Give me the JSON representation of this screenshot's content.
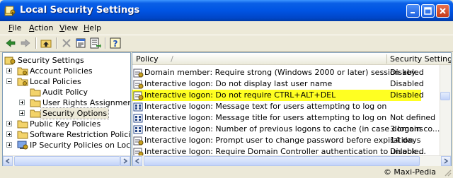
{
  "window": {
    "title": "Local Security Settings"
  },
  "menu": [
    {
      "label": "File",
      "key": "F",
      "rest": "ile"
    },
    {
      "label": "Action",
      "key": "A",
      "rest": "ction"
    },
    {
      "label": "View",
      "key": "V",
      "rest": "iew"
    },
    {
      "label": "Help",
      "key": "H",
      "rest": "elp"
    }
  ],
  "toolbar": [
    "back-icon",
    "forward-icon",
    "up-folder-icon",
    "delete-icon",
    "properties-icon",
    "export-list-icon",
    "help-icon"
  ],
  "tree": {
    "root": "Security Settings",
    "items": [
      {
        "label": "Account Policies"
      },
      {
        "label": "Local Policies"
      },
      {
        "label": "Audit Policy"
      },
      {
        "label": "User Rights Assignment"
      },
      {
        "label": "Security Options"
      },
      {
        "label": "Public Key Policies"
      },
      {
        "label": "Software Restriction Policies"
      },
      {
        "label": "IP Security Policies on Local Co"
      }
    ]
  },
  "list": {
    "columns": {
      "policy": "Policy",
      "setting": "Security Setting"
    },
    "sort_indicator": "/",
    "highlight_color": "#ffff22",
    "rows": [
      {
        "policy": "Domain member: Require strong (Windows 2000 or later) session key",
        "setting": "Disabled",
        "icon": "policy-toggle-icon"
      },
      {
        "policy": "Interactive logon: Do not display last user name",
        "setting": "Disabled",
        "icon": "policy-toggle-icon"
      },
      {
        "policy": "Interactive logon: Do not require CTRL+ALT+DEL",
        "setting": "Disabled",
        "icon": "policy-toggle-icon"
      },
      {
        "policy": "Interactive logon: Message text for users attempting to log on",
        "setting": "",
        "icon": "policy-text-icon"
      },
      {
        "policy": "Interactive logon: Message title for users attempting to log on",
        "setting": "Not defined",
        "icon": "policy-text-icon"
      },
      {
        "policy": "Interactive logon: Number of previous logons to cache (in case domain co...",
        "setting": "3 logons",
        "icon": "policy-text-icon"
      },
      {
        "policy": "Interactive logon: Prompt user to change password before expiration",
        "setting": "14 days",
        "icon": "policy-toggle-icon"
      },
      {
        "policy": "Interactive logon: Require Domain Controller authentication to unlock ...",
        "setting": "Disabled",
        "icon": "policy-toggle-icon"
      }
    ]
  },
  "status": {
    "credit": "© Maxi-Pedia"
  }
}
